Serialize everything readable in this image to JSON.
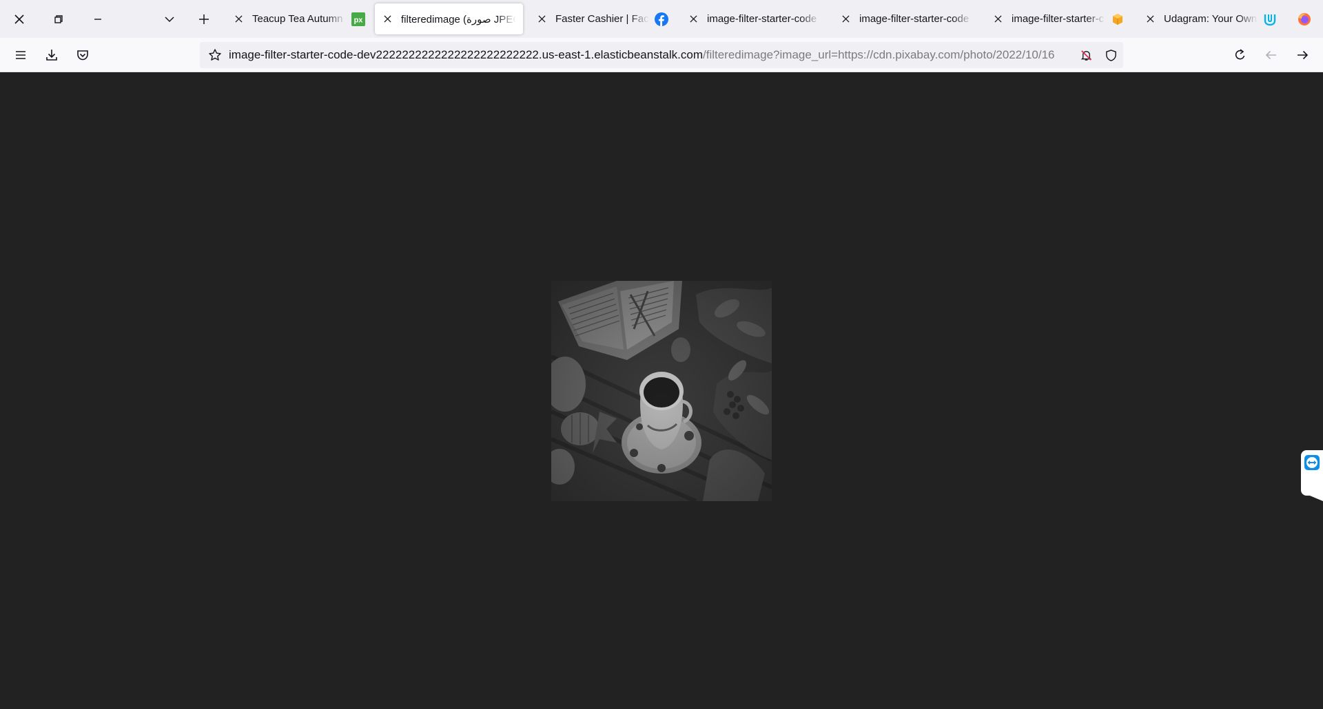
{
  "browser": {
    "tabs": [
      {
        "title": "Teacup Tea Autumn - ",
        "favicon": "pixabay-icon",
        "active": false
      },
      {
        "title": "filteredimage (صورة JPEG",
        "favicon": "",
        "active": true
      },
      {
        "title": "Faster Cashier | Facebo",
        "favicon": "facebook-icon",
        "active": false
      },
      {
        "title": "image-filter-starter-code",
        "favicon": "",
        "active": false
      },
      {
        "title": "image-filter-starter-code",
        "favicon": "",
        "active": false
      },
      {
        "title": "image-filter-starter-c",
        "favicon": "aws-box-icon",
        "active": false
      },
      {
        "title": "Udagram: Your Own I",
        "favicon": "udacity-icon",
        "active": false
      }
    ],
    "pixabay_favicon_text": "px",
    "url": {
      "domain": "image-filter-starter-code-dev2222222222222222222222222.us-east-1.elasticbeanstalk.com",
      "path": "/filteredimage?image_url=https://cdn.pixabay.com/photo/2022/10/16"
    },
    "colors": {
      "tabstrip": "#f0f0f4",
      "navbar": "#f9f9fb",
      "content_background": "#222222",
      "facebook": "#1877f2",
      "pixabay": "#48a947",
      "udacity": "#02b3e4",
      "aws_box": "#f5a623"
    }
  },
  "content": {
    "image_alt": "grayscale photo of a teacup on a saucer beside an open book, pumpkins and autumn leaves"
  }
}
